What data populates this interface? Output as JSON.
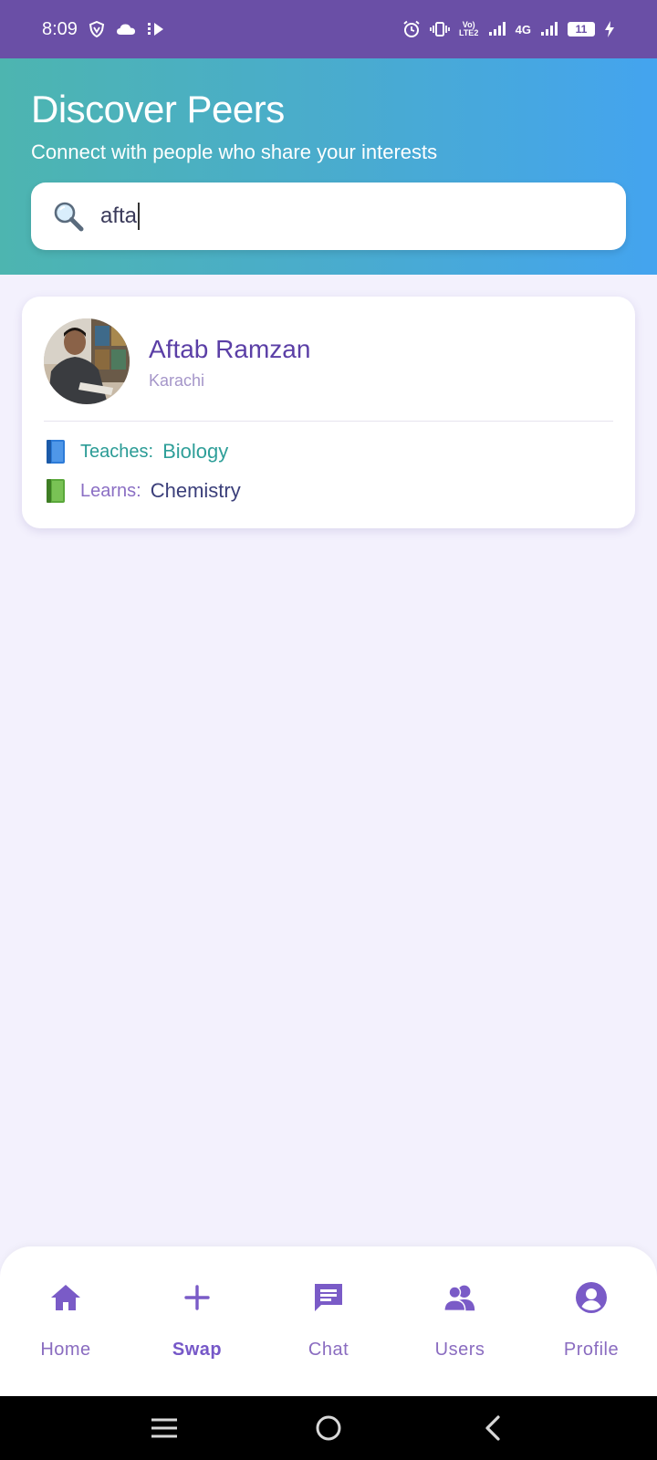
{
  "status_bar": {
    "time": "8:09",
    "network_label": "4G",
    "volte_label": "Vo) LTE2",
    "battery_level": "11"
  },
  "header": {
    "title": "Discover Peers",
    "subtitle": "Connect with people who share your interests"
  },
  "search": {
    "value": "afta",
    "icon": "magnifier-icon"
  },
  "results": [
    {
      "name": "Aftab Ramzan",
      "city": "Karachi",
      "teaches_label": "Teaches:",
      "teaches_value": "Biology",
      "learns_label": "Learns:",
      "learns_value": "Chemistry"
    }
  ],
  "bottom_nav": {
    "items": [
      {
        "label": "Home",
        "icon": "home-icon"
      },
      {
        "label": "Swap",
        "icon": "plus-icon",
        "active": true
      },
      {
        "label": "Chat",
        "icon": "chat-icon"
      },
      {
        "label": "Users",
        "icon": "users-icon"
      },
      {
        "label": "Profile",
        "icon": "profile-icon"
      }
    ]
  },
  "colors": {
    "status_bar": "#6a4fa6",
    "header_start": "#4db5b0",
    "header_end": "#44a4ef",
    "accent_purple": "#7658c8",
    "teal": "#2a9b95",
    "page_bg": "#f3f1fd"
  }
}
